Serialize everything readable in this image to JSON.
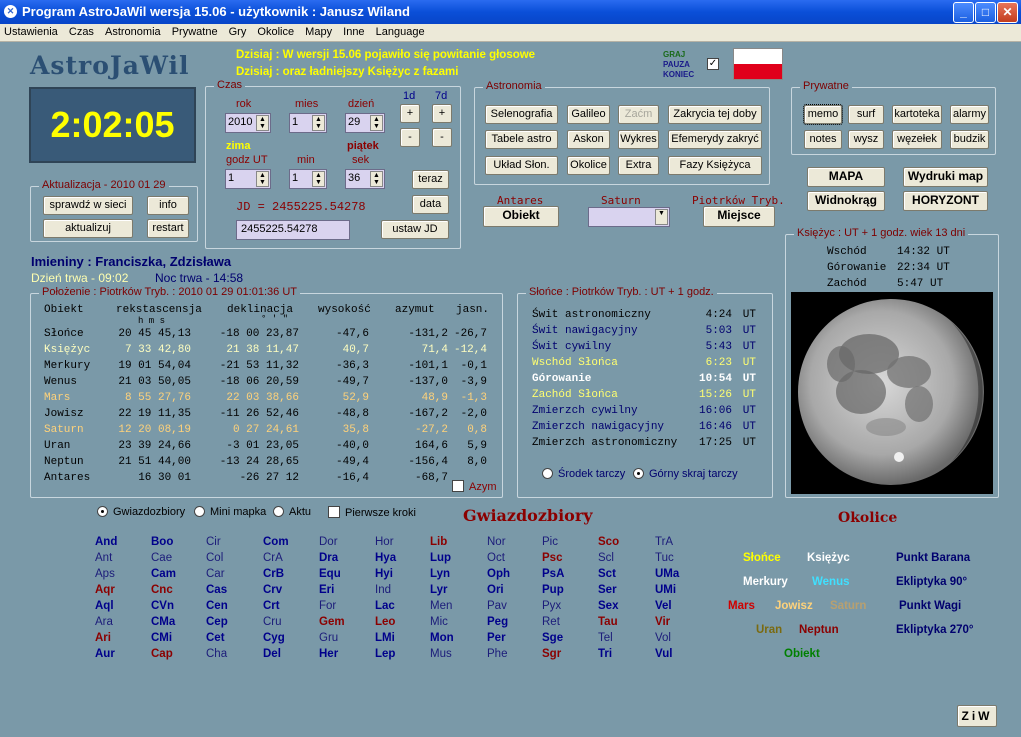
{
  "window": {
    "title": "Program AstroJaWil wersja 15.06 - użytkownik : Janusz Wiland"
  },
  "menu": [
    "Ustawienia",
    "Czas",
    "Astronomia",
    "Prywatne",
    "Gry",
    "Okolice",
    "Mapy",
    "Inne",
    "Language"
  ],
  "logo": "AstroJaWil",
  "news": [
    "Dzisiaj : W wersji 15.06 pojawiło się powitanie głosowe",
    "Dzisiaj : oraz ładniejszy Księżyc z fazami"
  ],
  "game": {
    "graj": "GRAJ",
    "pauza": "PAUZA",
    "koniec": "KONIEC",
    "check": "✓"
  },
  "clock": "2:02:05",
  "aktualizacja": {
    "title": "Aktualizacja - 2010 01 29",
    "buttons": [
      "sprawdź w sieci",
      "info",
      "aktualizuj",
      "restart"
    ]
  },
  "czas": {
    "title": "Czas",
    "labels": {
      "rok": "rok",
      "mies": "mies",
      "dzien": "dzień",
      "d1": "1d",
      "d7": "7d",
      "zima": "zima",
      "godz": "godz UT",
      "min": "min",
      "sek": "sek",
      "piatek": "piątek"
    },
    "values": {
      "rok": "2010",
      "mies": "1",
      "dzien": "29",
      "godz": "1",
      "min": "1",
      "sek": "36"
    },
    "plus": "+",
    "minus": "-",
    "teraz": "teraz",
    "data": "data",
    "jd_label": "JD = 2455225.54278",
    "jd_value": "2455225.54278",
    "ustaw_jd": "ustaw JD"
  },
  "astronomia": {
    "title": "Astronomia",
    "row1": [
      "Selenografia",
      "Galileo",
      "Zaćm",
      "Zakrycia tej doby"
    ],
    "row2": [
      "Tabele astro",
      "Askon",
      "Wykres",
      "Efemerydy zakryć"
    ],
    "row3": [
      "Układ Słon.",
      "Okolice",
      "Extra",
      "Fazy Księżyca"
    ]
  },
  "prywatne": {
    "title": "Prywatne",
    "row1": [
      "memo",
      "surf",
      "kartoteka",
      "alarmy"
    ],
    "row2": [
      "notes",
      "wysz",
      "węzełek",
      "budzik"
    ]
  },
  "maps": [
    "MAPA",
    "Wydruki map",
    "Widnokrąg",
    "HORYZONT"
  ],
  "obiekt": {
    "antares": "Antares",
    "obiekt_btn": "Obiekt",
    "saturn": "Saturn",
    "piotrkow": "Piotrków Tryb.",
    "miejsce_btn": "Miejsce"
  },
  "imieniny": {
    "text": "Imieniny : Franciszka, Zdzisława",
    "dzien": "Dzień trwa - 09:02",
    "noc": "Noc trwa - 14:58"
  },
  "polozenie": {
    "title": "Położenie : Piotrków Tryb. : 2010 01 29   01:01:36 UT",
    "headers": [
      "Obiekt",
      "rekstascensja",
      "deklinacja",
      "wysokość",
      "azymut",
      "jasn."
    ],
    "subheaders": "h  m  s",
    "subdeg": "°  '  \"",
    "rows": [
      {
        "name": "Słońce",
        "ra": "20 45 45,13",
        "dec": "-18 00 23,87",
        "alt": "-47,6",
        "az": "-131,2",
        "mag": "-26,7",
        "color": "#000"
      },
      {
        "name": "Księżyc",
        "ra": "7 33 42,80",
        "dec": "21 38 11,47",
        "alt": "40,7",
        "az": "71,4",
        "mag": "-12,4",
        "color": "#ffffc0"
      },
      {
        "name": "Merkury",
        "ra": "19 01 54,04",
        "dec": "-21 53 11,32",
        "alt": "-36,3",
        "az": "-101,1",
        "mag": "-0,1",
        "color": "#000"
      },
      {
        "name": "Wenus",
        "ra": "21 03 50,05",
        "dec": "-18 06 20,59",
        "alt": "-49,7",
        "az": "-137,0",
        "mag": "-3,9",
        "color": "#000"
      },
      {
        "name": "Mars",
        "ra": "8 55 27,76",
        "dec": "22 03 38,66",
        "alt": "52,9",
        "az": "48,9",
        "mag": "-1,3",
        "color": "#ffd27a"
      },
      {
        "name": "Jowisz",
        "ra": "22 19 11,35",
        "dec": "-11 26 52,46",
        "alt": "-48,8",
        "az": "-167,2",
        "mag": "-2,0",
        "color": "#000"
      },
      {
        "name": "Saturn",
        "ra": "12 20 08,19",
        "dec": "0 27 24,61",
        "alt": "35,8",
        "az": "-27,2",
        "mag": "0,8",
        "color": "#ffd27a"
      },
      {
        "name": "Uran",
        "ra": "23 39 24,66",
        "dec": "-3 01 23,05",
        "alt": "-40,0",
        "az": "164,6",
        "mag": "5,9",
        "color": "#000"
      },
      {
        "name": "Neptun",
        "ra": "21 51 44,00",
        "dec": "-13 24 28,65",
        "alt": "-49,4",
        "az": "-156,4",
        "mag": "8,0",
        "color": "#000"
      },
      {
        "name": "Antares",
        "ra": "16 30 01",
        "dec": "-26 27 12",
        "alt": "-16,4",
        "az": "-68,7",
        "mag": "",
        "color": "#000"
      }
    ],
    "azym": "Azym"
  },
  "slonce": {
    "title": "Słońce : Piotrków Tryb. : UT + 1 godz.",
    "rows": [
      {
        "name": "Świt astronomiczny",
        "time": "4:24",
        "unit": "UT",
        "color": "#000",
        "bold": false
      },
      {
        "name": "Świt nawigacyjny",
        "time": "5:03",
        "unit": "UT",
        "color": "#00006e",
        "bold": false
      },
      {
        "name": "Świt cywilny",
        "time": "5:43",
        "unit": "UT",
        "color": "#00006e",
        "bold": false
      },
      {
        "name": "Wschód Słońca",
        "time": "6:23",
        "unit": "UT",
        "color": "#ffff70",
        "bold": false
      },
      {
        "name": "Górowanie",
        "time": "10:54",
        "unit": "UT",
        "color": "#ffffff",
        "bold": true
      },
      {
        "name": "Zachód Słońca",
        "time": "15:26",
        "unit": "UT",
        "color": "#ffff70",
        "bold": false
      },
      {
        "name": "Zmierzch cywilny",
        "time": "16:06",
        "unit": "UT",
        "color": "#00006e",
        "bold": false
      },
      {
        "name": "Zmierzch nawigacyjny",
        "time": "16:46",
        "unit": "UT",
        "color": "#00006e",
        "bold": false
      },
      {
        "name": "Zmierzch astronomiczny",
        "time": "17:25",
        "unit": "UT",
        "color": "#000",
        "bold": false
      }
    ],
    "radio1": "Środek tarczy",
    "radio2": "Górny skraj tarczy"
  },
  "ksiezyc": {
    "title": "Księżyc : UT + 1 godz.   wiek 13 dni",
    "rows": [
      [
        "Wschód",
        "14:32 UT"
      ],
      [
        "Górowanie",
        "22:34 UT"
      ],
      [
        "Zachód",
        "5:47 UT"
      ]
    ]
  },
  "bottom_radios": [
    "Gwiazdozbiory",
    "Mini mapka",
    "Aktu",
    "Pierwsze kroki"
  ],
  "gwiazdozbiory_title": "Gwiazdozbiory",
  "constellations": [
    [
      {
        "t": "And",
        "c": "#00008b",
        "b": 1
      },
      {
        "t": "Ant",
        "c": "#1c1c7a",
        "b": 0
      },
      {
        "t": "Aps",
        "c": "#1c1c7a",
        "b": 0
      },
      {
        "t": "Aqr",
        "c": "#8b0000",
        "b": 1
      },
      {
        "t": "Aql",
        "c": "#00008b",
        "b": 1
      },
      {
        "t": "Ara",
        "c": "#1c1c7a",
        "b": 0
      },
      {
        "t": "Ari",
        "c": "#8b0000",
        "b": 1
      },
      {
        "t": "Aur",
        "c": "#00008b",
        "b": 1
      }
    ],
    [
      {
        "t": "Boo",
        "c": "#00008b",
        "b": 1
      },
      {
        "t": "Cae",
        "c": "#1c1c7a",
        "b": 0
      },
      {
        "t": "Cam",
        "c": "#00008b",
        "b": 1
      },
      {
        "t": "Cnc",
        "c": "#8b0000",
        "b": 1
      },
      {
        "t": "CVn",
        "c": "#00008b",
        "b": 1
      },
      {
        "t": "CMa",
        "c": "#00008b",
        "b": 1
      },
      {
        "t": "CMi",
        "c": "#00008b",
        "b": 1
      },
      {
        "t": "Cap",
        "c": "#8b0000",
        "b": 1
      }
    ],
    [
      {
        "t": "Cir",
        "c": "#1c1c7a",
        "b": 0
      },
      {
        "t": "Col",
        "c": "#1c1c7a",
        "b": 0
      },
      {
        "t": "Car",
        "c": "#1c1c7a",
        "b": 0
      },
      {
        "t": "Cas",
        "c": "#00008b",
        "b": 1
      },
      {
        "t": "Cen",
        "c": "#00008b",
        "b": 1
      },
      {
        "t": "Cep",
        "c": "#00008b",
        "b": 1
      },
      {
        "t": "Cet",
        "c": "#00008b",
        "b": 1
      },
      {
        "t": "Cha",
        "c": "#1c1c7a",
        "b": 0
      }
    ],
    [
      {
        "t": "Com",
        "c": "#00008b",
        "b": 1
      },
      {
        "t": "CrA",
        "c": "#1c1c7a",
        "b": 0
      },
      {
        "t": "CrB",
        "c": "#00008b",
        "b": 1
      },
      {
        "t": "Crv",
        "c": "#00008b",
        "b": 1
      },
      {
        "t": "Crt",
        "c": "#00008b",
        "b": 1
      },
      {
        "t": "Cru",
        "c": "#1c1c7a",
        "b": 0
      },
      {
        "t": "Cyg",
        "c": "#00008b",
        "b": 1
      },
      {
        "t": "Del",
        "c": "#00008b",
        "b": 1
      }
    ],
    [
      {
        "t": "Dor",
        "c": "#1c1c7a",
        "b": 0
      },
      {
        "t": "Dra",
        "c": "#00008b",
        "b": 1
      },
      {
        "t": "Equ",
        "c": "#00008b",
        "b": 1
      },
      {
        "t": "Eri",
        "c": "#00008b",
        "b": 1
      },
      {
        "t": "For",
        "c": "#1c1c7a",
        "b": 0
      },
      {
        "t": "Gem",
        "c": "#8b0000",
        "b": 1
      },
      {
        "t": "Gru",
        "c": "#1c1c7a",
        "b": 0
      },
      {
        "t": "Her",
        "c": "#00008b",
        "b": 1
      }
    ],
    [
      {
        "t": "Hor",
        "c": "#1c1c7a",
        "b": 0
      },
      {
        "t": "Hya",
        "c": "#00008b",
        "b": 1
      },
      {
        "t": "Hyi",
        "c": "#00008b",
        "b": 1
      },
      {
        "t": "Ind",
        "c": "#1c1c7a",
        "b": 0
      },
      {
        "t": "Lac",
        "c": "#00008b",
        "b": 1
      },
      {
        "t": "Leo",
        "c": "#8b0000",
        "b": 1
      },
      {
        "t": "LMi",
        "c": "#00008b",
        "b": 1
      },
      {
        "t": "Lep",
        "c": "#00008b",
        "b": 1
      }
    ],
    [
      {
        "t": "Lib",
        "c": "#8b0000",
        "b": 1
      },
      {
        "t": "Lup",
        "c": "#00008b",
        "b": 1
      },
      {
        "t": "Lyn",
        "c": "#00008b",
        "b": 1
      },
      {
        "t": "Lyr",
        "c": "#00008b",
        "b": 1
      },
      {
        "t": "Men",
        "c": "#1c1c7a",
        "b": 0
      },
      {
        "t": "Mic",
        "c": "#1c1c7a",
        "b": 0
      },
      {
        "t": "Mon",
        "c": "#00008b",
        "b": 1
      },
      {
        "t": "Mus",
        "c": "#1c1c7a",
        "b": 0
      }
    ],
    [
      {
        "t": "Nor",
        "c": "#1c1c7a",
        "b": 0
      },
      {
        "t": "Oct",
        "c": "#1c1c7a",
        "b": 0
      },
      {
        "t": "Oph",
        "c": "#00008b",
        "b": 1
      },
      {
        "t": "Ori",
        "c": "#00008b",
        "b": 1
      },
      {
        "t": "Pav",
        "c": "#1c1c7a",
        "b": 0
      },
      {
        "t": "Peg",
        "c": "#00008b",
        "b": 1
      },
      {
        "t": "Per",
        "c": "#00008b",
        "b": 1
      },
      {
        "t": "Phe",
        "c": "#1c1c7a",
        "b": 0
      }
    ],
    [
      {
        "t": "Pic",
        "c": "#1c1c7a",
        "b": 0
      },
      {
        "t": "Psc",
        "c": "#8b0000",
        "b": 1
      },
      {
        "t": "PsA",
        "c": "#00008b",
        "b": 1
      },
      {
        "t": "Pup",
        "c": "#00008b",
        "b": 1
      },
      {
        "t": "Pyx",
        "c": "#1c1c7a",
        "b": 0
      },
      {
        "t": "Ret",
        "c": "#1c1c7a",
        "b": 0
      },
      {
        "t": "Sge",
        "c": "#00008b",
        "b": 1
      },
      {
        "t": "Sgr",
        "c": "#8b0000",
        "b": 1
      }
    ],
    [
      {
        "t": "Sco",
        "c": "#8b0000",
        "b": 1
      },
      {
        "t": "Scl",
        "c": "#1c1c7a",
        "b": 0
      },
      {
        "t": "Sct",
        "c": "#00008b",
        "b": 1
      },
      {
        "t": "Ser",
        "c": "#00008b",
        "b": 1
      },
      {
        "t": "Sex",
        "c": "#00008b",
        "b": 1
      },
      {
        "t": "Tau",
        "c": "#8b0000",
        "b": 1
      },
      {
        "t": "Tel",
        "c": "#1c1c7a",
        "b": 0
      },
      {
        "t": "Tri",
        "c": "#00008b",
        "b": 1
      }
    ],
    [
      {
        "t": "TrA",
        "c": "#1c1c7a",
        "b": 0
      },
      {
        "t": "Tuc",
        "c": "#1c1c7a",
        "b": 0
      },
      {
        "t": "UMa",
        "c": "#00008b",
        "b": 1
      },
      {
        "t": "UMi",
        "c": "#00008b",
        "b": 1
      },
      {
        "t": "Vel",
        "c": "#00008b",
        "b": 1
      },
      {
        "t": "Vir",
        "c": "#8b0000",
        "b": 1
      },
      {
        "t": "Vol",
        "c": "#1c1c7a",
        "b": 0
      },
      {
        "t": "Vul",
        "c": "#00008b",
        "b": 1
      }
    ]
  ],
  "okolice": {
    "title": "Okolice",
    "items": [
      {
        "t": "Słońce",
        "c": "#ffff00"
      },
      {
        "t": "Księżyc",
        "c": "#ffffff"
      },
      {
        "t": "Punkt Barana",
        "c": "#00006e"
      },
      {
        "t": "Merkury",
        "c": "#ffffff"
      },
      {
        "t": "Wenus",
        "c": "#40e0ff"
      },
      {
        "t": "Ekliptyka 90°",
        "c": "#00006e"
      },
      {
        "t": "Mars",
        "c": "#d00000"
      },
      {
        "t": "Jowisz",
        "c": "#ffd27a"
      },
      {
        "t": "Saturn",
        "c": "#b8a070"
      },
      {
        "t": "Punkt Wagi",
        "c": "#00006e"
      },
      {
        "t": "Uran",
        "c": "#7a6a10"
      },
      {
        "t": "Neptun",
        "c": "#8b0000"
      },
      {
        "t": "Ekliptyka 270°",
        "c": "#00006e"
      },
      {
        "t": "Obiekt",
        "c": "#008000"
      }
    ]
  },
  "ziw": "ZiW"
}
